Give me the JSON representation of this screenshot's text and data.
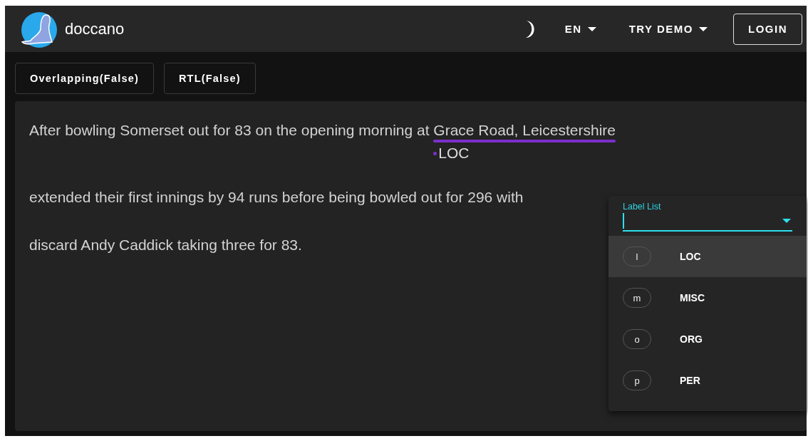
{
  "app_bar": {
    "title": "doccano",
    "language": "EN",
    "demo": "TRY DEMO",
    "login": "LOGIN"
  },
  "toggles": [
    {
      "label": "Overlapping(False)"
    },
    {
      "label": "RTL(False)"
    }
  ],
  "document": {
    "lines": [
      {
        "segments": [
          {
            "text": "After bowling Somerset out for 83 on the opening morning at "
          },
          {
            "text": "Grace Road, Leicestershire",
            "label": "LOC",
            "color": "#7b2fc9"
          }
        ]
      },
      {
        "segments": [
          {
            "text": "extended their first innings by 94 runs before being bowled out for 296 with"
          }
        ]
      },
      {
        "segments": [
          {
            "text": "discard Andy Caddick taking three for 83."
          }
        ]
      }
    ]
  },
  "label_menu": {
    "label": "Label List",
    "items": [
      {
        "key": "l",
        "name": "LOC",
        "selected": true
      },
      {
        "key": "m",
        "name": "MISC",
        "selected": false
      },
      {
        "key": "o",
        "name": "ORG",
        "selected": false
      },
      {
        "key": "p",
        "name": "PER",
        "selected": false
      }
    ]
  }
}
